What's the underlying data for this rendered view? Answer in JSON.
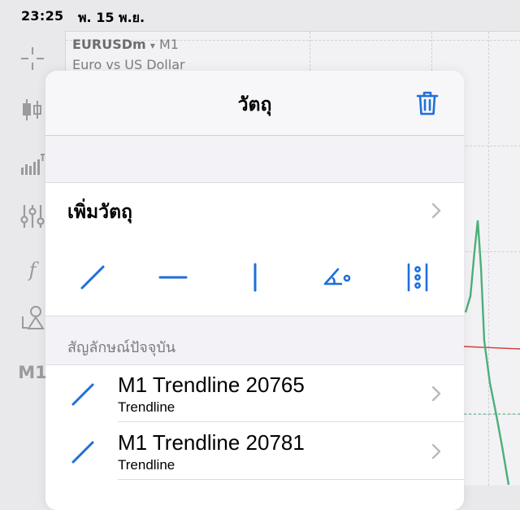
{
  "status_bar": {
    "time": "23:25",
    "date": "พ. 15 พ.ย."
  },
  "left_toolbar": {
    "items": [
      {
        "icon": "crosshair-icon"
      },
      {
        "icon": "candlestick-icon"
      },
      {
        "icon": "indicators-icon"
      },
      {
        "icon": "settings-sliders-icon"
      },
      {
        "icon": "function-icon",
        "text": "f"
      },
      {
        "icon": "objects-icon"
      },
      {
        "icon": "timeframe",
        "text": "M1"
      }
    ]
  },
  "chart": {
    "symbol": "EURUSDm",
    "dropdown_glyph": "▾",
    "timeframe": "M1",
    "description": "Euro vs US Dollar",
    "line_color": "#4caf7a",
    "level_color": "#d23b3b"
  },
  "sheet": {
    "title": "วัตถุ",
    "trash_icon": "trash-icon",
    "add_object_label": "เพิ่มวัตถุ",
    "tools": [
      {
        "icon": "trendline-tool-icon"
      },
      {
        "icon": "horizontal-line-tool-icon"
      },
      {
        "icon": "vertical-line-tool-icon"
      },
      {
        "icon": "angle-tool-icon"
      },
      {
        "icon": "fibonacci-tool-icon"
      }
    ],
    "section_header": "สัญลักษณ์ปัจจุบัน",
    "objects": [
      {
        "title": "M1 Trendline 20765",
        "type": "Trendline",
        "icon": "trendline-icon"
      },
      {
        "title": "M1 Trendline 20781",
        "type": "Trendline",
        "icon": "trendline-icon"
      }
    ],
    "accent_color": "#1e6fd9"
  }
}
